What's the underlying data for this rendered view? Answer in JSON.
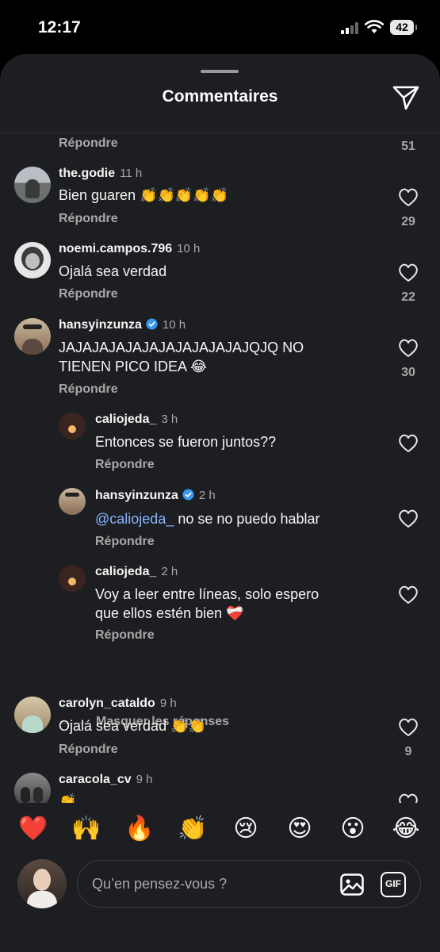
{
  "status": {
    "time": "12:17",
    "battery": "42"
  },
  "sheet": {
    "title": "Commentaires"
  },
  "reply_label": "Répondre",
  "top_fragment": {
    "likes": "51"
  },
  "comments": [
    {
      "username": "the.godie",
      "ago": "11 h",
      "text": "Bien guaren 👏👏👏👏👏",
      "likes": "29"
    },
    {
      "username": "noemi.campos.796",
      "ago": "10 h",
      "text": "Ojalá sea verdad",
      "likes": "22"
    },
    {
      "username": "hansyinzunza",
      "ago": "10 h",
      "text_line1": "JAJAJAJAJAJAJAJAJAJAJAJQJQ NO",
      "text_line2": "TIENEN PICO IDEA 😂",
      "likes": "30"
    },
    {
      "username": "caliojeda_",
      "ago": "3 h",
      "text": "Entonces se fueron juntos??"
    },
    {
      "username": "hansyinzunza",
      "ago": "2 h",
      "mention": "@caliojeda_",
      "text": " no se no puedo hablar"
    },
    {
      "username": "caliojeda_",
      "ago": "2 h",
      "text_line1": "Voy a leer entre líneas, solo espero",
      "text_line2": "que ellos estén bien ❤️‍🩹"
    },
    {
      "username": "carolyn_cataldo",
      "ago": "9 h",
      "text": "Ojalá sea verdad 👏👏",
      "likes": "9"
    },
    {
      "username": "caracola_cv",
      "ago": "9 h",
      "text": "👏"
    }
  ],
  "hide_replies_label": "Masquer les réponses",
  "reactions": [
    "❤️",
    "🙌",
    "🔥",
    "👏",
    "😢",
    "😍",
    "😮",
    "😂"
  ],
  "input": {
    "placeholder": "Qu’en pensez-vous ?",
    "gif_label": "GIF"
  },
  "colors": {
    "background": "#1c1e21",
    "verified": "#3897f0",
    "mention": "#8ab4ff",
    "secondary_text": "#a8a8a8"
  }
}
